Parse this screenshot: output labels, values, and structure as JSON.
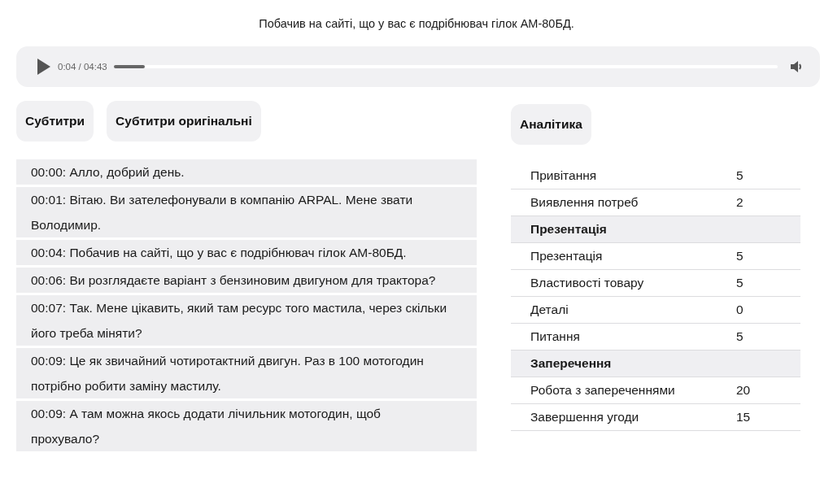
{
  "caption": "Побачив на сайті, що у вас є подрібнювач гілок АМ-80БД.",
  "player": {
    "time": "0:04 / 04:43"
  },
  "tabs": [
    {
      "label": "Субтитри"
    },
    {
      "label": "Субтитри оригінальні"
    }
  ],
  "transcript": [
    {
      "text": "00:00: Алло, добрий день."
    },
    {
      "text": "00:01: Вітаю. Ви зателефонували в компанію ARPAL. Мене звати Володимир."
    },
    {
      "text": "00:04: Побачив на сайті, що у вас є подрібнювач гілок АМ-80БД."
    },
    {
      "text": "00:06: Ви розглядаєте варіант з бензиновим двигуном для трактора?"
    },
    {
      "text": "00:07: Так. Мене цікавить, який там ресурс того мастила, через скільки його треба міняти?"
    },
    {
      "text": "00:09: Це як звичайний чотиротактний двигун. Раз в 100 мотогодин потрібно робити заміну мастилу."
    },
    {
      "text": "00:09: А там можна якось додати лічильник мотогодин, щоб прохувало?"
    }
  ],
  "analytics": {
    "tab": "Аналітика",
    "rows": [
      {
        "kind": "item",
        "label": "Привітання",
        "value": "5"
      },
      {
        "kind": "item",
        "label": "Виявлення потреб",
        "value": "2"
      },
      {
        "kind": "section",
        "label": "Презентація"
      },
      {
        "kind": "item",
        "label": "Презентація",
        "value": "5"
      },
      {
        "kind": "item",
        "label": "Властивості товару",
        "value": "5"
      },
      {
        "kind": "item",
        "label": "Деталі",
        "value": "0"
      },
      {
        "kind": "item",
        "label": "Питання",
        "value": "5"
      },
      {
        "kind": "section",
        "label": "Заперечення"
      },
      {
        "kind": "item",
        "label": "Робота з запереченнями",
        "value": "20"
      },
      {
        "kind": "item",
        "label": "Завершення угоди",
        "value": "15"
      }
    ]
  }
}
